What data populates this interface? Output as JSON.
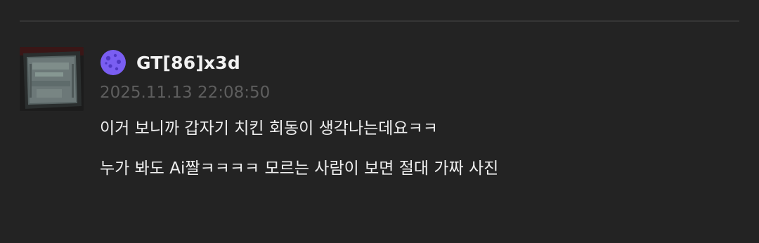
{
  "comment": {
    "username": "GT[86]x3d",
    "timestamp": "2025.11.13 22:08:50",
    "level_badge_icon": "purple-planet-level-icon",
    "avatar_icon": "cpu-chip-photo-avatar",
    "lines": [
      "이거 보니까 갑자기 치킨 회동이 생각나는데요ㅋㅋ",
      "누가 봐도 Ai짤ㅋㅋㅋㅋ 모르는 사람이 보면 절대 가짜 사진"
    ]
  },
  "colors": {
    "background": "#232323",
    "username": "#f2f2f2",
    "timestamp": "#5e5e5e",
    "body_text": "#efefef",
    "badge_purple": "#7a5ef2"
  }
}
